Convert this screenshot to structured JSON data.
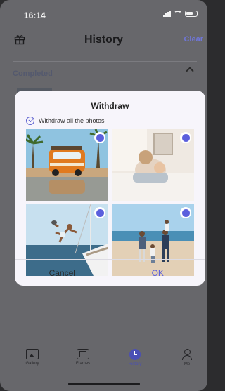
{
  "status_bar": {
    "time": "16:14"
  },
  "header": {
    "title": "History",
    "clear_label": "Clear"
  },
  "section": {
    "label": "Completed"
  },
  "dialog": {
    "title": "Withdraw",
    "withdraw_all_label": "Withdraw all the photos",
    "photos": [
      {
        "subject": "orange van on beach",
        "selected": true
      },
      {
        "subject": "mother and baby on bed",
        "selected": true
      },
      {
        "subject": "man jumping off sailboat",
        "selected": true
      },
      {
        "subject": "family on beach",
        "selected": true
      }
    ],
    "cancel_label": "Cancel",
    "ok_label": "OK"
  },
  "nav": {
    "items": [
      {
        "label": "Gallery",
        "icon": "gallery-icon"
      },
      {
        "label": "Frames",
        "icon": "frames-icon"
      },
      {
        "label": "History",
        "icon": "history-icon",
        "active": true
      },
      {
        "label": "Me",
        "icon": "person-icon"
      }
    ]
  },
  "colors": {
    "accent": "#5b5fdd",
    "overlay": "#67676b",
    "dialog_bg": "#f7f5fb"
  }
}
